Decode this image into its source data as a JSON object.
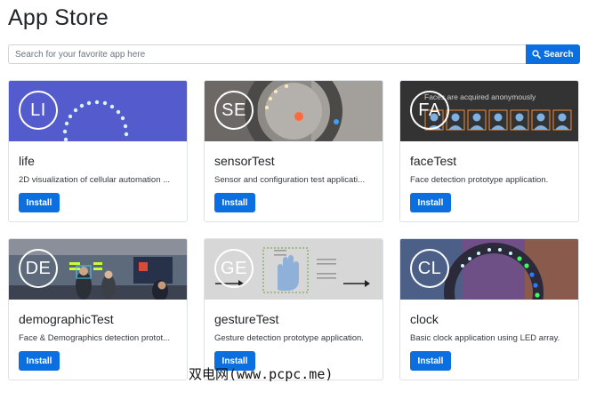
{
  "header": {
    "title": "App Store"
  },
  "search": {
    "placeholder": "Search for your favorite app here",
    "button_label": "Search"
  },
  "apps": [
    {
      "initials": "LI",
      "name": "life",
      "description": "2D visualization of cellular automation ...",
      "button": "Install"
    },
    {
      "initials": "SE",
      "name": "sensorTest",
      "description": "Sensor and configuration test applicati...",
      "button": "Install"
    },
    {
      "initials": "FA",
      "name": "faceTest",
      "description": "Face detection prototype application.",
      "button": "Install"
    },
    {
      "initials": "DE",
      "name": "demographicTest",
      "description": "Face & Demographics detection protot...",
      "button": "Install"
    },
    {
      "initials": "GE",
      "name": "gestureTest",
      "description": "Gesture detection prototype application.",
      "button": "Install"
    },
    {
      "initials": "CL",
      "name": "clock",
      "description": "Basic clock application using LED array.",
      "button": "Install"
    }
  ],
  "images": {
    "faceTest_caption": "Faces are acquired anonymously"
  },
  "watermark": "双电网(www.pcpc.me)",
  "colors": {
    "primary": "#0b6fe0",
    "border": "#dee2e6"
  }
}
